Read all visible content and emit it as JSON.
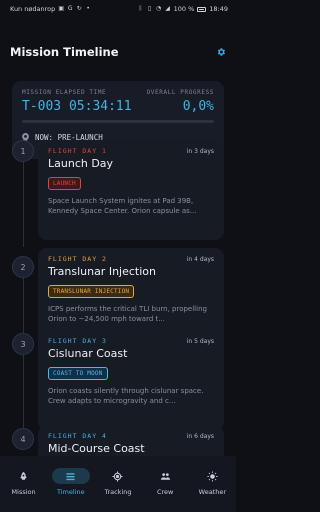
{
  "status_bar": {
    "left_text": "Kun nødanrop",
    "battery": "100 %",
    "time": "18:49"
  },
  "header": {
    "title": "Mission Timeline",
    "settings_icon": "gear-icon"
  },
  "mission_status": {
    "elapsed_label": "MISSION ELAPSED TIME",
    "elapsed_value": "T-003 05:34:11",
    "progress_label": "OVERALL PROGRESS",
    "progress_value": "0,0%",
    "progress_fraction": 0.0,
    "now_text": "NOW: PRE-LAUNCH"
  },
  "timeline": [
    {
      "number": "1",
      "day": "FLIGHT DAY 1",
      "eta": "in 3 days",
      "title": "Launch Day",
      "badge": "LAUNCH",
      "description": "Space Launch System ignites at Pad 39B, Kennedy Space Center. Orion capsule as...",
      "day_color": "#e0443e",
      "badge_color": "#e0443e",
      "badge_bg": "#3a1a1e"
    },
    {
      "number": "2",
      "day": "FLIGHT DAY 2",
      "eta": "in 4 days",
      "title": "Translunar Injection",
      "badge": "TRANSLUNAR INJECTION",
      "description": "ICPS performs the critical TLI burn, propelling Orion to ~24,500 mph toward t...",
      "day_color": "#e0a03a",
      "badge_color": "#e6a63c",
      "badge_bg": "#3a2c14"
    },
    {
      "number": "3",
      "day": "FLIGHT DAY 3",
      "eta": "in 5 days",
      "title": "Cislunar Coast",
      "badge": "COAST TO MOON",
      "description": "Orion coasts silently through cislunar space. Crew adapts to microgravity and c...",
      "day_color": "#3fb6e6",
      "badge_color": "#4fb8e8",
      "badge_bg": "#13304a"
    },
    {
      "number": "4",
      "day": "FLIGHT DAY 4",
      "eta": "in 6 days",
      "title": "Mid-Course Coast",
      "badge": "",
      "description": "",
      "day_color": "#3fb6e6",
      "badge_color": "#4fb8e8",
      "badge_bg": "#13304a"
    }
  ],
  "nav": [
    {
      "label": "Mission",
      "icon": "rocket-icon",
      "active": false
    },
    {
      "label": "Timeline",
      "icon": "timeline-icon",
      "active": true
    },
    {
      "label": "Tracking",
      "icon": "target-icon",
      "active": false
    },
    {
      "label": "Crew",
      "icon": "people-icon",
      "active": false
    },
    {
      "label": "Weather",
      "icon": "sun-icon",
      "active": false
    }
  ]
}
